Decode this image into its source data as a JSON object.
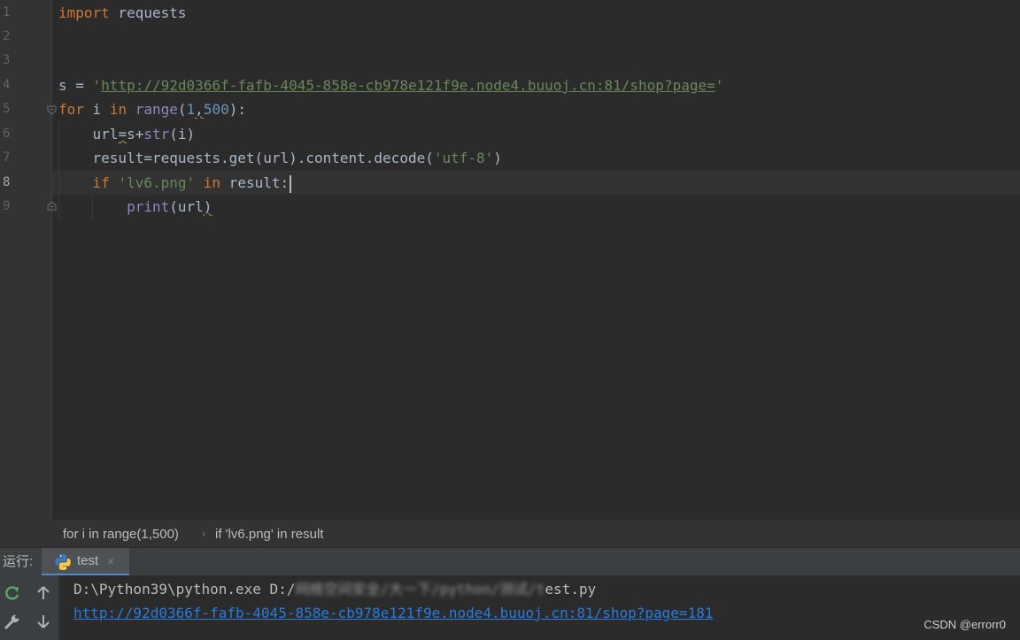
{
  "editor": {
    "line_numbers": [
      "1",
      "2",
      "3",
      "4",
      "5",
      "6",
      "7",
      "8",
      "9"
    ],
    "code": {
      "l1_kw": "import",
      "l1_rest": " requests",
      "l4_var": "s = ",
      "l4_q1": "'",
      "l4_url": "http://92d0366f-fafb-4045-858e-cb978e121f9e.node4.buuoj.cn:81/shop?page=",
      "l4_q2": "'",
      "l5_kw_for": "for",
      "l5_i": " i ",
      "l5_kw_in": "in",
      "l5_sp": " ",
      "l5_range": "range",
      "l5_open": "(",
      "l5_num1": "1",
      "l5_comma": ",",
      "l5_num2": "500",
      "l5_close": "):",
      "l6_a": "    url",
      "l6_eq": "=",
      "l6_b": "s+",
      "l6_str": "str",
      "l6_c": "(i)",
      "l7_a": "    result=requests.get(url).content.decode(",
      "l7_str": "'utf-8'",
      "l7_b": ")",
      "l8_kw_if": "    if",
      "l8_sp": " ",
      "l8_str": "'lv6.png'",
      "l8_sp2": " ",
      "l8_kw_in": "in",
      "l8_rest": " result:",
      "l9_ind": "        ",
      "l9_print": "print",
      "l9_a": "(url",
      "l9_b": ")"
    }
  },
  "breadcrumb": {
    "item1": "for i in range(1,500)",
    "sep": "›",
    "item2": "if 'lv6.png' in result"
  },
  "run_panel": {
    "label": "运行:",
    "tab_label": "test",
    "tab_close": "×",
    "console": {
      "line1_a": "D:\\Python39\\python.exe D:/",
      "line1_blur": "网络空间安全/大一下/python/测试/t",
      "line1_b": "est.py",
      "line2_link": "http://92d0366f-fafb-4045-858e-cb978e121f9e.node4.buuoj.cn:81/shop?page=181"
    }
  },
  "watermark": "CSDN @errorr0",
  "colors": {
    "keyword": "#cc7832",
    "string": "#6a8759",
    "number": "#6897bb",
    "builtin": "#8888c6",
    "link": "#287bde"
  }
}
